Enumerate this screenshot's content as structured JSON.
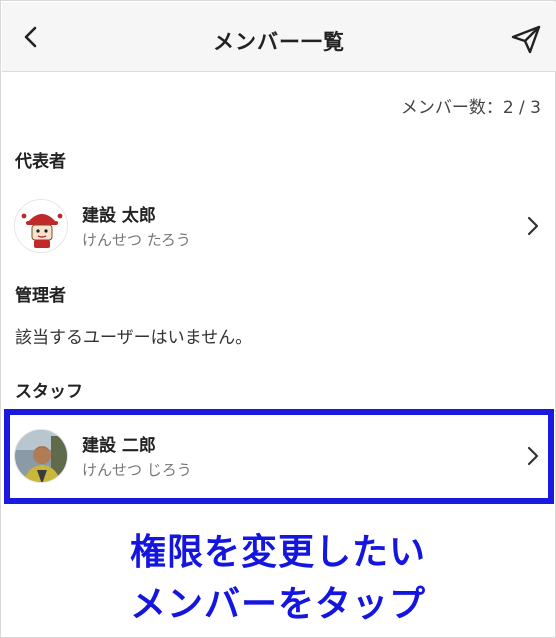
{
  "header": {
    "title": "メンバー一覧"
  },
  "member_count": "メンバー数：2 / 3",
  "sections": {
    "representative": {
      "label": "代表者",
      "member": {
        "name": "建設 太郎",
        "kana": "けんせつ たろう"
      }
    },
    "admin": {
      "label": "管理者",
      "empty_text": "該当するユーザーはいません。"
    },
    "staff": {
      "label": "スタッフ",
      "member": {
        "name": "建設 二郎",
        "kana": "けんせつ じろう"
      }
    }
  },
  "caption": {
    "line1": "権限を変更したい",
    "line2": "メンバーをタップ"
  },
  "colors": {
    "highlight": "#1a1adf",
    "caption": "#1515e0",
    "mascot": "#c0282a"
  },
  "icons": [
    "back-arrow-icon",
    "send-icon",
    "chevron-right-icon"
  ]
}
